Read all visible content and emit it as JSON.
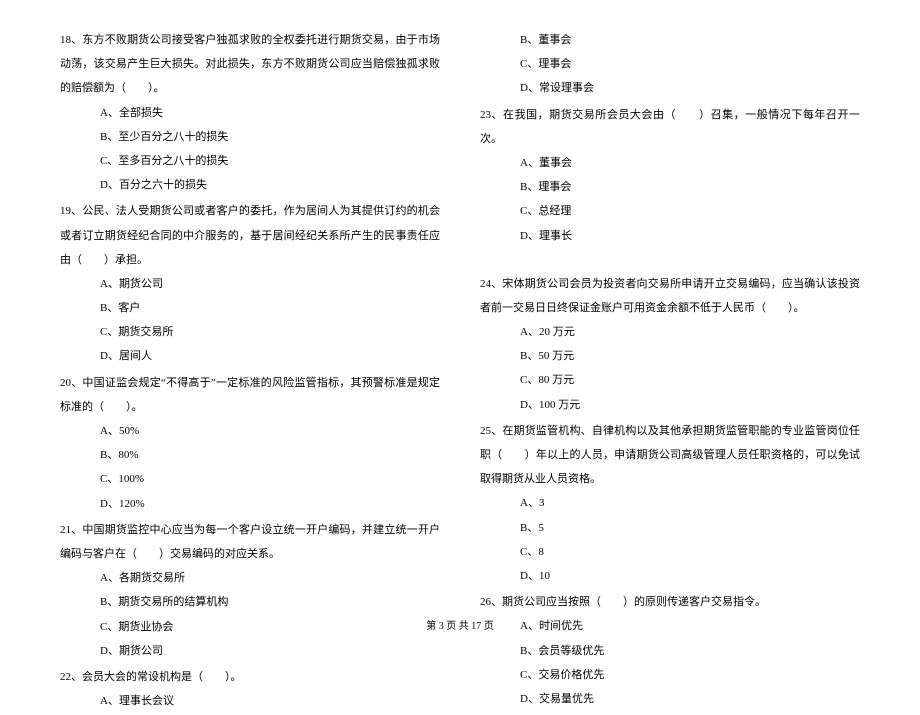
{
  "left": {
    "q18": {
      "text": "18、东方不败期货公司接受客户独孤求败的全权委托进行期货交易，由于市场动荡，该交易产生巨大损失。对此损失，东方不败期货公司应当赔偿独孤求败的赔偿额为（　　）。",
      "a": "A、全部损失",
      "b": "B、至少百分之八十的损失",
      "c": "C、至多百分之八十的损失",
      "d": "D、百分之六十的损失"
    },
    "q19": {
      "text": "19、公民、法人受期货公司或者客户的委托，作为居间人为其提供订约的机会或者订立期货经纪合同的中介服务的，基于居间经纪关系所产生的民事责任应由（　　）承担。",
      "a": "A、期货公司",
      "b": "B、客户",
      "c": "C、期货交易所",
      "d": "D、居间人"
    },
    "q20": {
      "text": "20、中国证监会规定“不得高于”一定标准的风险监管指标，其预警标准是规定标准的（　　）。",
      "a": "A、50%",
      "b": "B、80%",
      "c": "C、100%",
      "d": "D、120%"
    },
    "q21": {
      "text": "21、中国期货监控中心应当为每一个客户设立统一开户编码，并建立统一开户编码与客户在（　　）交易编码的对应关系。",
      "a": "A、各期货交易所",
      "b": "B、期货交易所的结算机构",
      "c": "C、期货业协会",
      "d": "D、期货公司"
    },
    "q22": {
      "text": "22、会员大会的常设机构是（　　）。",
      "a": "A、理事长会议"
    }
  },
  "right": {
    "q22": {
      "b": "B、董事会",
      "c": "C、理事会",
      "d": "D、常设理事会"
    },
    "q23": {
      "text": "23、在我国，期货交易所会员大会由（　　）召集，一般情况下每年召开一次。",
      "a": "A、董事会",
      "b": "B、理事会",
      "c": "C、总经理",
      "d": "D、理事长"
    },
    "q24": {
      "text": "24、宋体期货公司会员为投资者向交易所申请开立交易编码，应当确认该投资者前一交易日日终保证金账户可用资金余额不低于人民币（　　）。",
      "a": "A、20 万元",
      "b": "B、50 万元",
      "c": "C、80 万元",
      "d": "D、100 万元"
    },
    "q25": {
      "text": "25、在期货监管机构、自律机构以及其他承担期货监管职能的专业监管岗位任职（　　）年以上的人员，申请期货公司高级管理人员任职资格的，可以免试取得期货从业人员资格。",
      "a": "A、3",
      "b": "B、5",
      "c": "C、8",
      "d": "D、10"
    },
    "q26": {
      "text": "26、期货公司应当按照（　　）的原则传递客户交易指令。",
      "a": "A、时间优先",
      "b": "B、会员等级优先",
      "c": "C、交易价格优先",
      "d": "D、交易量优先"
    }
  },
  "footer": "第 3 页 共 17 页"
}
